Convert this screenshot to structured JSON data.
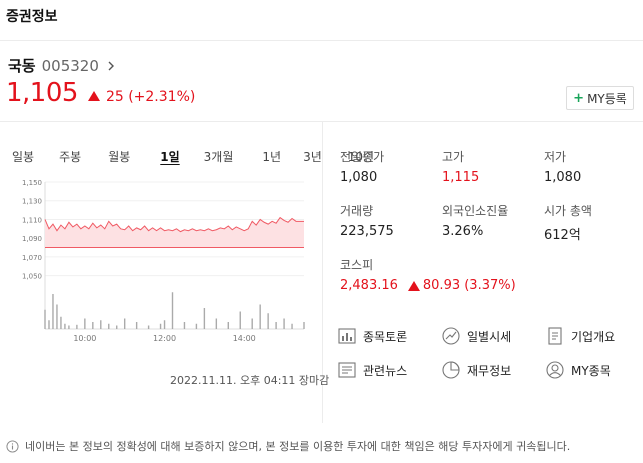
{
  "section_title": "증권정보",
  "stock": {
    "name": "국동",
    "code": "005320",
    "price": "1,105",
    "change": "25 (+2.31%)",
    "my_button_label": "MY등록"
  },
  "period_tabs": [
    {
      "label": "일봉",
      "active": false
    },
    {
      "label": "주봉",
      "active": false
    },
    {
      "label": "월봉",
      "active": false
    },
    {
      "label": "1일",
      "active": true
    },
    {
      "label": "3개월",
      "active": false
    },
    {
      "label": "1년",
      "active": false
    },
    {
      "label": "3년",
      "active": false
    },
    {
      "label": "10년",
      "active": false
    }
  ],
  "chart_data": {
    "type": "line",
    "y_ticks": [
      "1,150",
      "1,130",
      "1,110",
      "1,090",
      "1,070",
      "1,050"
    ],
    "x_ticks": [
      "10:00",
      "12:00",
      "14:00"
    ],
    "ylim": [
      1040,
      1150
    ],
    "x_range": [
      9,
      15.5
    ],
    "reference_value": 1080,
    "price_x": [
      9,
      9.1,
      9.2,
      9.3,
      9.4,
      9.5,
      9.6,
      9.7,
      9.8,
      9.9,
      10.0,
      10.1,
      10.2,
      10.3,
      10.4,
      10.5,
      10.6,
      10.7,
      10.8,
      10.9,
      11.0,
      11.1,
      11.2,
      11.3,
      11.4,
      11.5,
      11.6,
      11.7,
      11.8,
      11.9,
      12.0,
      12.1,
      12.2,
      12.3,
      12.4,
      12.5,
      12.6,
      12.7,
      12.8,
      12.9,
      13.0,
      13.1,
      13.2,
      13.3,
      13.4,
      13.5,
      13.6,
      13.7,
      13.8,
      13.9,
      14.0,
      14.1,
      14.2,
      14.3,
      14.4,
      14.5,
      14.6,
      14.7,
      14.8,
      14.9,
      15.0,
      15.1,
      15.2,
      15.3,
      15.5
    ],
    "price_y": [
      1110,
      1100,
      1105,
      1098,
      1104,
      1100,
      1107,
      1102,
      1105,
      1100,
      1103,
      1100,
      1106,
      1101,
      1104,
      1100,
      1108,
      1103,
      1105,
      1100,
      1099,
      1103,
      1098,
      1101,
      1099,
      1103,
      1098,
      1101,
      1098,
      1101,
      1098,
      1099,
      1098,
      1100,
      1097,
      1099,
      1098,
      1100,
      1098,
      1099,
      1098,
      1100,
      1098,
      1099,
      1101,
      1100,
      1103,
      1099,
      1102,
      1100,
      1098,
      1100,
      1108,
      1104,
      1110,
      1107,
      1105,
      1108,
      1106,
      1112,
      1109,
      1107,
      1111,
      1108,
      1108
    ],
    "volume_x": [
      9.0,
      9.1,
      9.2,
      9.3,
      9.4,
      9.5,
      9.6,
      9.8,
      10.0,
      10.2,
      10.4,
      10.6,
      10.8,
      11.0,
      11.3,
      11.6,
      11.9,
      12.0,
      12.2,
      12.5,
      12.8,
      13.0,
      13.3,
      13.6,
      13.9,
      14.2,
      14.4,
      14.6,
      14.8,
      15.0,
      15.2,
      15.5
    ],
    "volume_y": [
      0.55,
      0.25,
      1.0,
      0.7,
      0.35,
      0.15,
      0.1,
      0.12,
      0.3,
      0.2,
      0.25,
      0.15,
      0.1,
      0.3,
      0.2,
      0.1,
      0.15,
      0.25,
      1.05,
      0.2,
      0.15,
      0.6,
      0.3,
      0.2,
      0.5,
      0.3,
      0.7,
      0.45,
      0.2,
      0.3,
      0.15,
      0.2
    ]
  },
  "date_line": "2022.11.11. 오후 04:11 장마감",
  "stats": [
    {
      "label": "전일종가",
      "value": "1,080",
      "red": false
    },
    {
      "label": "고가",
      "value": "1,115",
      "red": true
    },
    {
      "label": "저가",
      "value": "1,080",
      "red": false
    },
    {
      "label": "거래량",
      "value": "223,575",
      "red": false
    },
    {
      "label": "외국인소진율",
      "value": "3.26%",
      "red": false
    },
    {
      "label": "시가 총액",
      "value": "612억",
      "red": false
    }
  ],
  "index": {
    "label": "코스피",
    "value": "2,483.16",
    "change": "80.93 (3.37%)"
  },
  "links": [
    {
      "label": "종목토론",
      "icon": "chart-bars-icon"
    },
    {
      "label": "일별시세",
      "icon": "trend-circle-icon"
    },
    {
      "label": "기업개요",
      "icon": "document-icon"
    },
    {
      "label": "관련뉴스",
      "icon": "news-icon"
    },
    {
      "label": "재무정보",
      "icon": "arc-circle-icon"
    },
    {
      "label": "MY종목",
      "icon": "person-icon"
    }
  ],
  "notice": "네이버는 본 정보의 정확성에 대해 보증하지 않으며, 본 정보를 이용한 투자에 대한 책임은 해당 투자자에게 귀속됩니다.",
  "colors": {
    "up_red": "#e3121c",
    "chart_line": "#f05a64",
    "chart_fill": "#fde1e3",
    "volume_bar": "#aaaaaa",
    "plus_green": "#19a55a"
  }
}
